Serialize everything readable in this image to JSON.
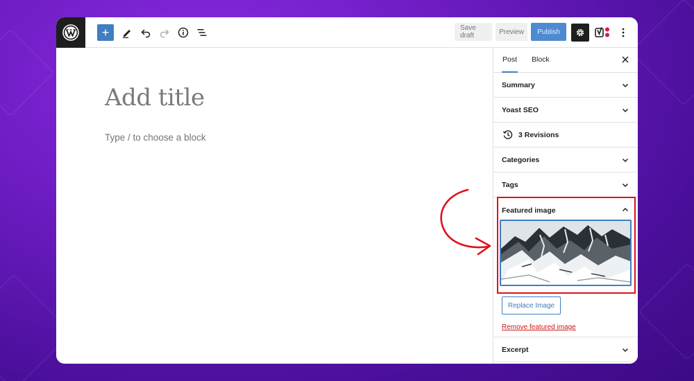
{
  "toolbar": {
    "save_draft_label": "Save draft",
    "preview_label": "Preview",
    "publish_label": "Publish",
    "add_block_symbol": "+"
  },
  "editor": {
    "title_placeholder": "Add title",
    "block_placeholder": "Type / to choose a block"
  },
  "sidebar": {
    "tabs": [
      {
        "label": "Post",
        "active": true
      },
      {
        "label": "Block",
        "active": false
      }
    ],
    "panels": {
      "summary": "Summary",
      "yoast": "Yoast SEO",
      "revisions": "3 Revisions",
      "categories": "Categories",
      "tags": "Tags",
      "featured_image": "Featured image",
      "excerpt": "Excerpt"
    },
    "featured": {
      "replace_label": "Replace Image",
      "remove_label": "Remove featured image"
    }
  },
  "colors": {
    "accent": "#3f7ec0",
    "highlight": "#e0101a",
    "danger_link": "#cc1818",
    "background_purple": "#6a1bbf"
  }
}
